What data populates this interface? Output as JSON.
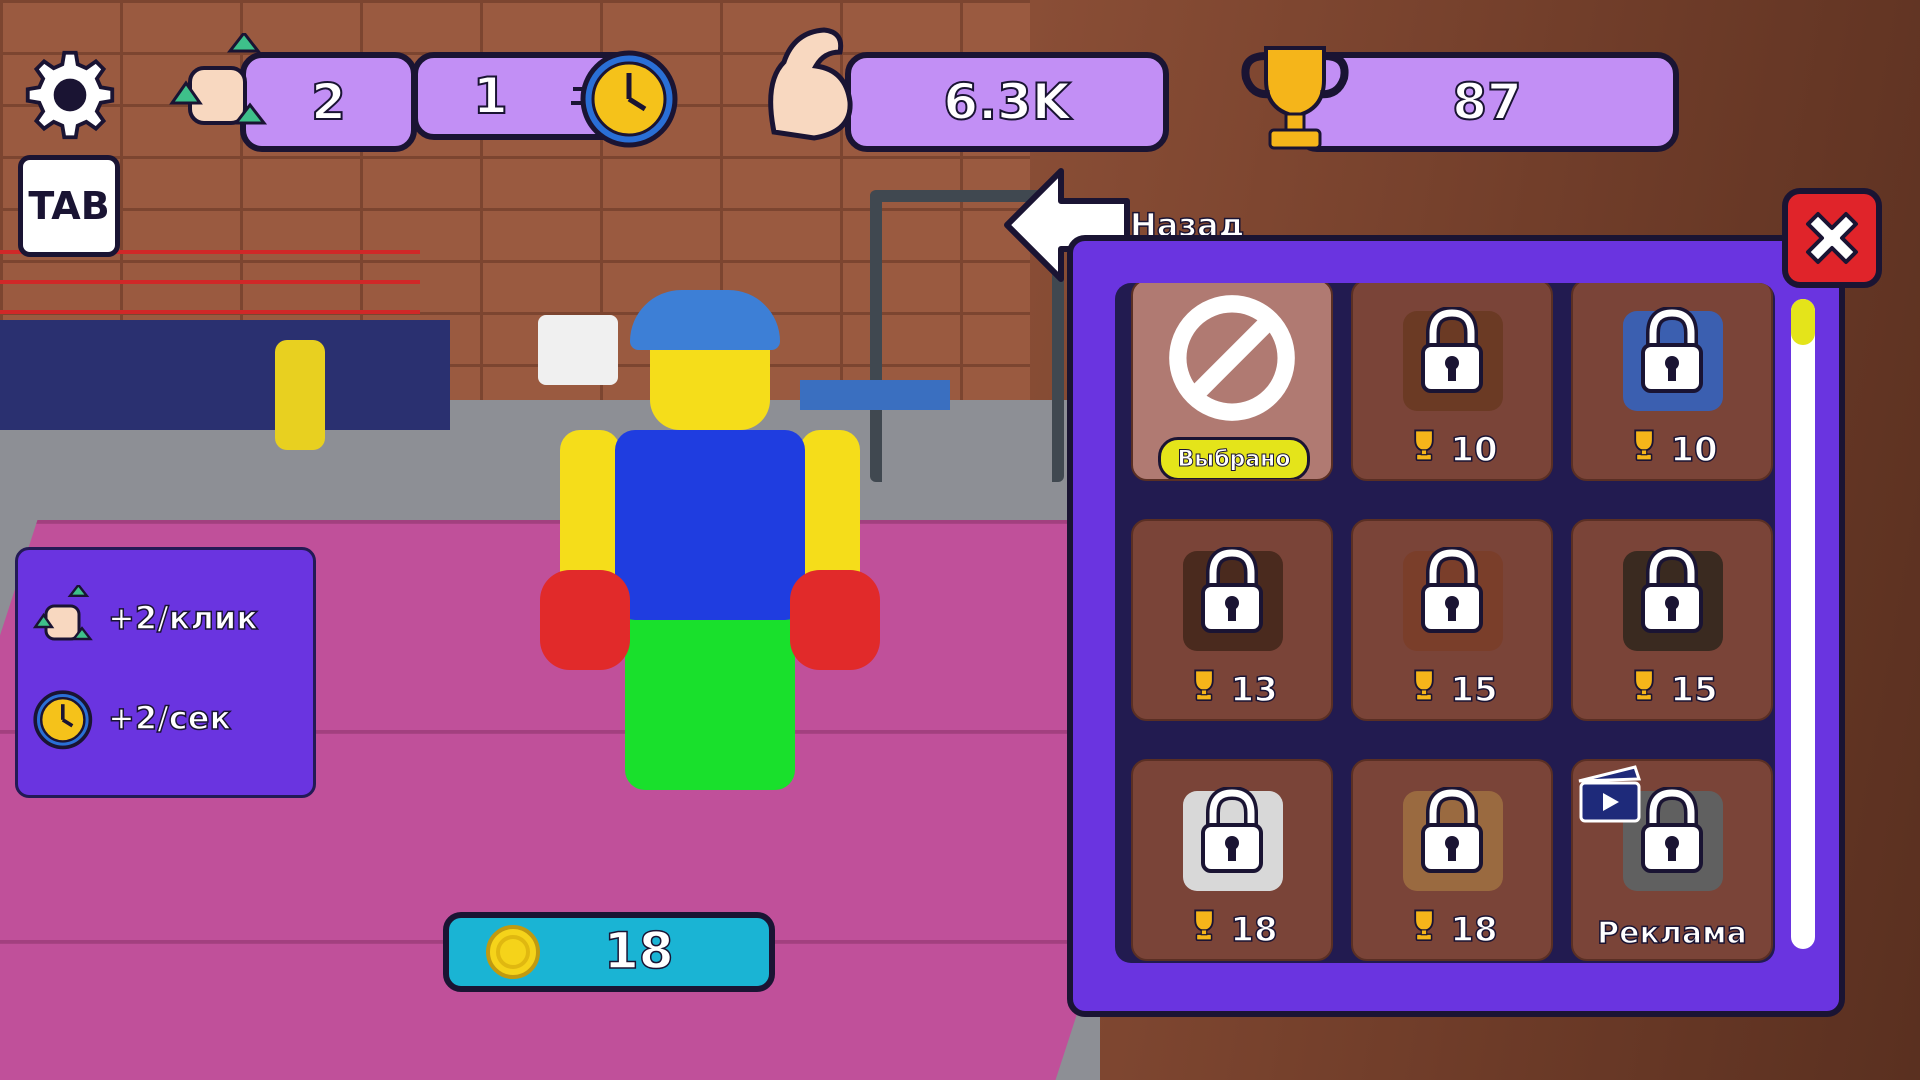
{
  "hud": {
    "settings_icon": "gear-icon",
    "click_power": "2",
    "speed": "1",
    "strength": "6.3K",
    "trophies": "87",
    "tab_label": "TAB"
  },
  "panel": {
    "per_click": "+2/клик",
    "per_sec": "+2/сек"
  },
  "coins": {
    "value": "18"
  },
  "shop": {
    "back_label": "Назад",
    "scroll_position": 0.0,
    "items": [
      {
        "state": "selected",
        "badge": "Выбрано",
        "icon": "none-icon"
      },
      {
        "state": "locked",
        "price": "10",
        "color": "#6b3a24"
      },
      {
        "state": "locked",
        "price": "10",
        "color": "#3b5fb0"
      },
      {
        "state": "locked",
        "price": "13",
        "color": "#4a2a1e"
      },
      {
        "state": "locked",
        "price": "15",
        "color": "#7a3e2a"
      },
      {
        "state": "locked",
        "price": "15",
        "color": "#3a2a20"
      },
      {
        "state": "locked",
        "price": "18",
        "color": "#d8d8d8"
      },
      {
        "state": "locked",
        "price": "18",
        "color": "#9a6a40"
      },
      {
        "state": "locked_ad",
        "price": "Реклама",
        "color": "#606060"
      }
    ]
  },
  "colors": {
    "hud_pill": "#c28ff5",
    "panel": "#6a34e0",
    "coin_bar": "#1ab4d4",
    "close": "#e0242a",
    "badge": "#e4e41a"
  }
}
